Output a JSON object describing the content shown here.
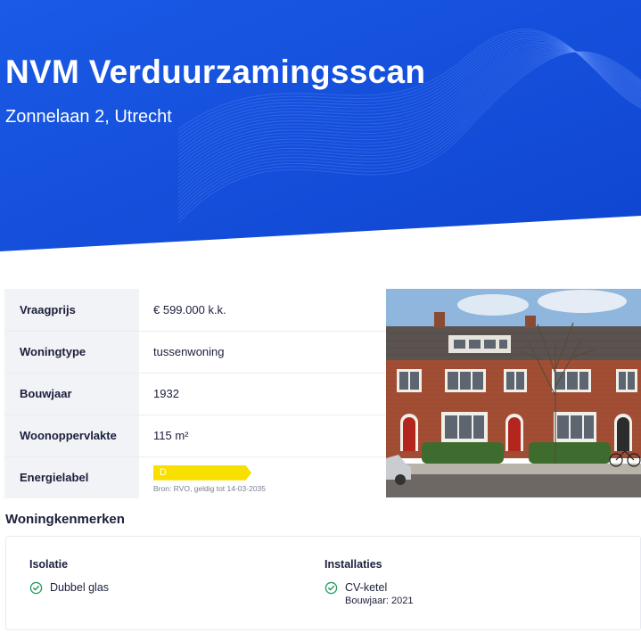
{
  "hero": {
    "title": "NVM Verduurzamingsscan",
    "address": "Zonnelaan 2, Utrecht",
    "bg_color": "#1651de"
  },
  "property": {
    "rows": [
      {
        "label": "Vraagprijs",
        "value": "€ 599.000 k.k."
      },
      {
        "label": "Woningtype",
        "value": "tussenwoning"
      },
      {
        "label": "Bouwjaar",
        "value": "1932"
      },
      {
        "label": "Woonoppervlakte",
        "value": "115 m²"
      }
    ],
    "energy": {
      "label": "Energielabel",
      "value": "D",
      "color": "#f7e000",
      "source": "Bron: RVO, geldig tot 14-03-2035"
    }
  },
  "features": {
    "title": "Woningkenmerken",
    "isolatie": {
      "title": "Isolatie",
      "items": [
        "Dubbel glas"
      ]
    },
    "installaties": {
      "title": "Installaties",
      "items": [
        "CV-ketel"
      ],
      "item_sub": "Bouwjaar: 2021"
    },
    "check_color": "#1f9a5a"
  }
}
